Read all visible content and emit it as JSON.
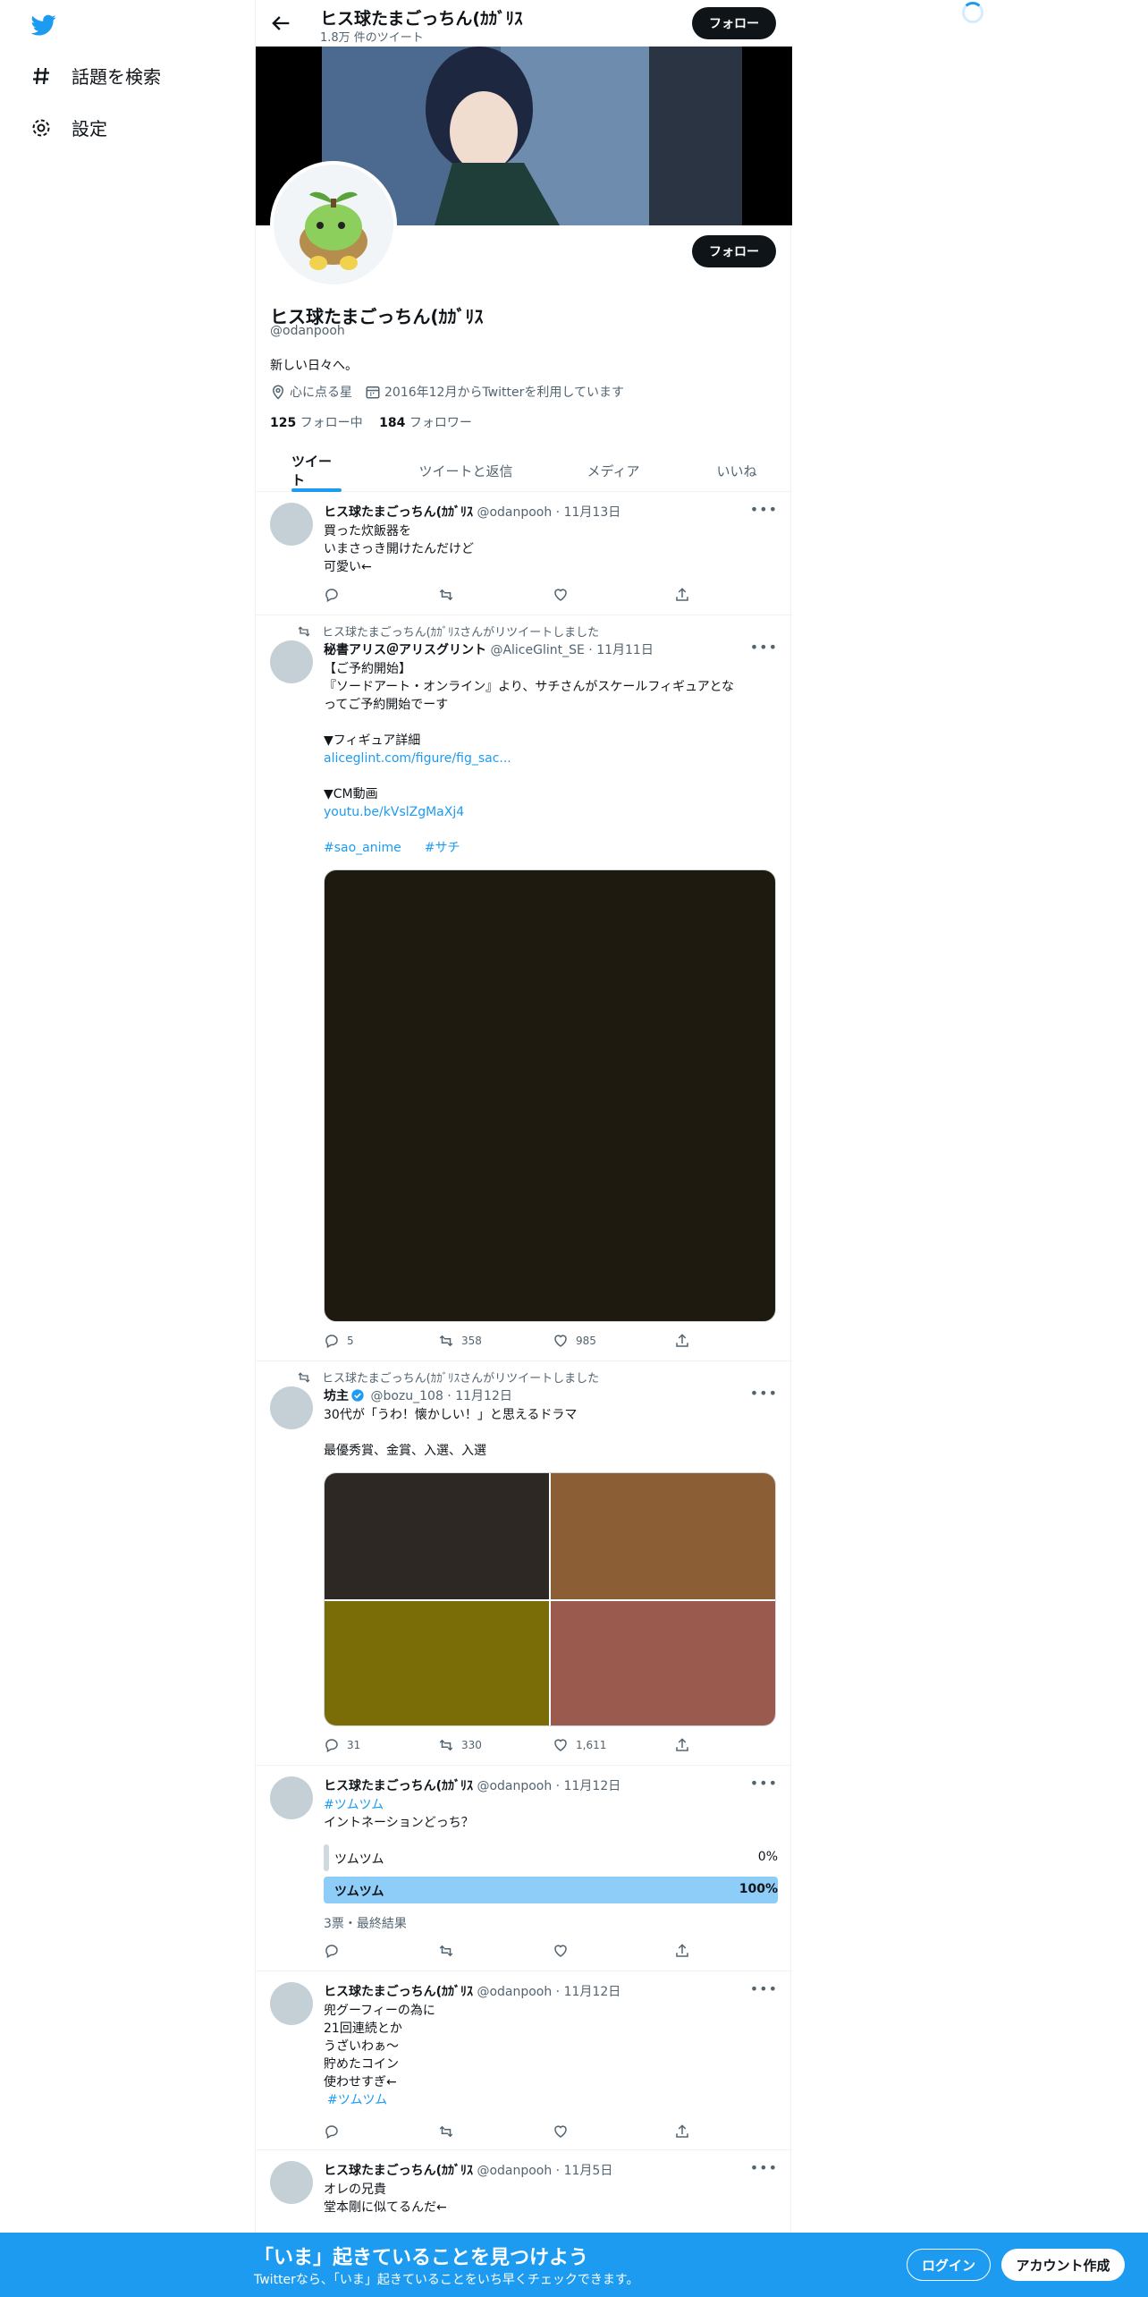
{
  "sidebar": {
    "items": [
      {
        "label": "話題を検索",
        "icon": "hashtag-icon"
      },
      {
        "label": "設定",
        "icon": "gear-icon"
      }
    ]
  },
  "header": {
    "title": "ヒス球たまごっちん(ｶｶﾞﾘｽ",
    "tweet_count": "1.8万 件のツイート",
    "follow_label": "フォロー"
  },
  "profile": {
    "name": "ヒス球たまごっちん(ｶｶﾞﾘｽ",
    "handle": "@odanpooh",
    "bio": "新しい日々へ。",
    "location": "心に点る星",
    "joined": "2016年12月からTwitterを利用しています",
    "following_count": "125",
    "following_label": "フォロー中",
    "followers_count": "184",
    "followers_label": "フォロワー",
    "follow_label": "フォロー"
  },
  "tabs": [
    "ツイート",
    "ツイートと返信",
    "メディア",
    "いいね"
  ],
  "tweets": [
    {
      "name": "ヒス球たまごっちん(ｶｶﾞﾘｽ",
      "handle": "@odanpooh",
      "date": "11月13日",
      "lines": [
        "買った炊飯器を",
        "いまさっき開けたんだけど",
        "可愛い←"
      ]
    },
    {
      "retweeted_by": "ヒス球たまごっちん(ｶｶﾞﾘｽさんがリツイートしました",
      "name": "秘書アリス＠アリスグリント",
      "handle": "@AliceGlint_SE",
      "date": "11月11日",
      "line1": "【ご予約開始】",
      "line2": "『ソードアート・オンライン』より、サチさんがスケールフィギュアとな",
      "line3": "ってご予約開始でーす",
      "line4": "▼フィギュア詳細",
      "link1": "aliceglint.com/figure/fig_sac...",
      "line5": "▼CM動画",
      "link2": "youtu.be/kVslZgMaXj4",
      "tag1": "#sao_anime",
      "tag2": "#サチ",
      "replies": "5",
      "retweets": "358",
      "likes": "985"
    },
    {
      "retweeted_by": "ヒス球たまごっちん(ｶｶﾞﾘｽさんがリツイートしました",
      "name": "坊主",
      "handle": "@bozu_108",
      "date": "11月12日",
      "line1": "30代が「うわ！懐かしい！」と思えるドラマ",
      "line2": "最優秀賞、金賞、入選、入選",
      "replies": "31",
      "retweets": "330",
      "likes": "1,611",
      "colors": [
        "#2d2823",
        "#8b5e36",
        "#7a6d08",
        "#9a5a4e"
      ]
    },
    {
      "name": "ヒス球たまごっちん(ｶｶﾞﾘｽ",
      "handle": "@odanpooh",
      "date": "11月12日",
      "tag": "#ツムツム",
      "text": "イントネーションどっち？",
      "poll": [
        {
          "label": "ツムツム",
          "percent": "0%",
          "value": 0
        },
        {
          "label": "ツムツム",
          "percent": "100%",
          "value": 100
        }
      ],
      "poll_meta": "3票・最終結果"
    },
    {
      "name": "ヒス球たまごっちん(ｶｶﾞﾘｽ",
      "handle": "@odanpooh",
      "date": "11月12日",
      "lines": [
        "兜グーフィーの為に",
        "21回連続とか",
        "うざいわぁ〜",
        "貯めたコイン",
        "使わせすぎ←"
      ],
      "tag": "#ツムツム"
    },
    {
      "name": "ヒス球たまごっちん(ｶｶﾞﾘｽ",
      "handle": "@odanpooh",
      "date": "11月5日",
      "lines": [
        "オレの兄貴",
        "堂本剛に似てるんだ←"
      ]
    }
  ],
  "bottom_bar": {
    "title": "「いま」起きていることを見つけよう",
    "subtitle": "Twitterなら、「いま」起きていることをいち早くチェックできます。",
    "login_label": "ログイン",
    "signup_label": "アカウント作成"
  },
  "colors": {
    "accent": "#1d9bf0",
    "poll_fill": "#8ecdf8",
    "image_dark": "#1f1a10",
    "bottom_bar": "#1d9bf0"
  }
}
